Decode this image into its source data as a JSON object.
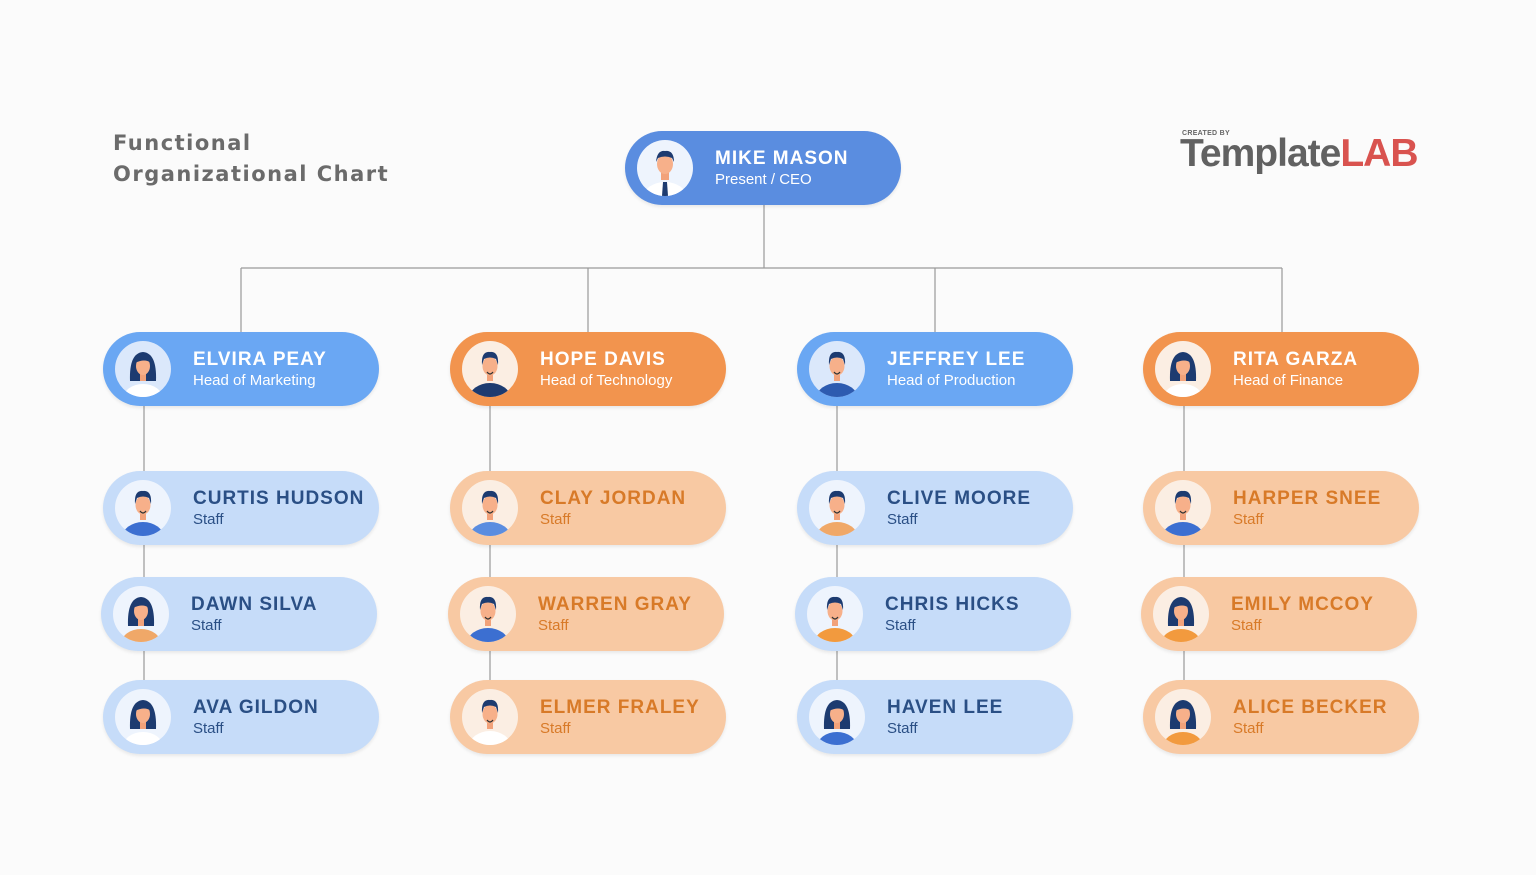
{
  "title": "Functional  Organizational Chart",
  "logo": {
    "created_by": "CREATED BY",
    "brand_part1": "Template",
    "brand_part2": "LAB"
  },
  "colors": {
    "ceo": "#5a8de0",
    "head_blue": "#6aa7f3",
    "head_orange": "#f2944e",
    "staff_blue": "#c6dcf9",
    "staff_orange": "#f8c9a3",
    "staff_blue_text": "#2a4f85",
    "staff_orange_text": "#d87a28",
    "connector": "#9a9a9a"
  },
  "ceo": {
    "name": "MIKE MASON",
    "role": "Present / CEO",
    "avatar": "man-tie-avatar-icon"
  },
  "departments": [
    {
      "head": {
        "name": "ELVIRA PEAY",
        "role": "Head of  Marketing",
        "avatar": "woman-avatar-icon"
      },
      "theme": "blue",
      "staff": [
        {
          "name": "CURTIS HUDSON",
          "role": "Staff",
          "avatar": "man-avatar-icon"
        },
        {
          "name": "DAWN  SILVA",
          "role": "Staff",
          "avatar": "woman-avatar-icon"
        },
        {
          "name": "AVA GILDON",
          "role": "Staff",
          "avatar": "woman-avatar-icon"
        }
      ]
    },
    {
      "head": {
        "name": "HOPE DAVIS",
        "role": "Head of  Technology",
        "avatar": "man-avatar-icon"
      },
      "theme": "orange",
      "staff": [
        {
          "name": "CLAY  JORDAN",
          "role": "Staff",
          "avatar": "man-avatar-icon"
        },
        {
          "name": "WARREN GRAY",
          "role": "Staff",
          "avatar": "man-avatar-icon"
        },
        {
          "name": "ELMER FRALEY",
          "role": "Staff",
          "avatar": "man-avatar-icon"
        }
      ]
    },
    {
      "head": {
        "name": "JEFFREY LEE",
        "role": "Head of Production",
        "avatar": "man-avatar-icon"
      },
      "theme": "blue",
      "staff": [
        {
          "name": "CLIVE MOORE",
          "role": "Staff",
          "avatar": "man-avatar-icon"
        },
        {
          "name": "CHRIS HICKS",
          "role": "Staff",
          "avatar": "man-avatar-icon"
        },
        {
          "name": "HAVEN LEE",
          "role": "Staff",
          "avatar": "woman-avatar-icon"
        }
      ]
    },
    {
      "head": {
        "name": "RITA GARZA",
        "role": "Head of Finance",
        "avatar": "woman-avatar-icon"
      },
      "theme": "orange",
      "staff": [
        {
          "name": "HARPER  SNEE",
          "role": "Staff",
          "avatar": "man-avatar-icon"
        },
        {
          "name": "EMILY MCCOY",
          "role": "Staff",
          "avatar": "woman-avatar-icon"
        },
        {
          "name": "ALICE BECKER",
          "role": "Staff",
          "avatar": "woman-avatar-icon"
        }
      ]
    }
  ]
}
